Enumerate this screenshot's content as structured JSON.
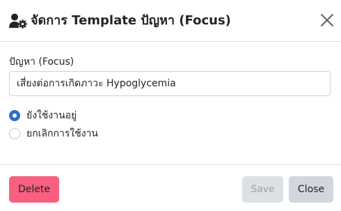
{
  "dialog": {
    "title": "จัดการ Template ปัญหา (Focus)",
    "header_icon": "user-gear-icon",
    "close_icon": "close-icon"
  },
  "form": {
    "problem_label": "ปัญหา (Focus)",
    "problem_value": "เสี่ยงต่อการเกิดภาวะ Hypoglycemia",
    "status_options": [
      {
        "label": "ยังใช้งานอยู่",
        "checked": true
      },
      {
        "label": "ยกเลิกการใช้งาน",
        "checked": false
      }
    ]
  },
  "footer": {
    "delete_label": "Delete",
    "save_label": "Save",
    "close_label": "Close"
  },
  "colors": {
    "primary": "#2f6fc8",
    "danger": "#f7607e",
    "secondary": "#d3d7dd",
    "border": "#dee2e6"
  }
}
